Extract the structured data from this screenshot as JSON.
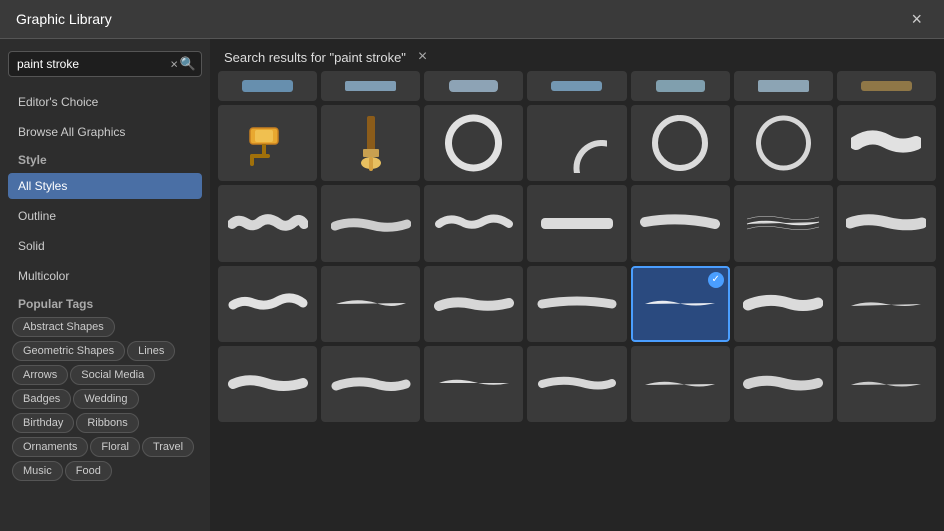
{
  "dialog": {
    "title": "Graphic Library",
    "close_label": "×"
  },
  "search": {
    "value": "paint stroke",
    "placeholder": "paint stroke",
    "clear_label": "×",
    "search_icon": "🔍"
  },
  "sidebar": {
    "editor_choice": "Editor's Choice",
    "browse_all": "Browse All Graphics",
    "style_label": "Style",
    "styles": [
      {
        "label": "All Styles",
        "active": true
      },
      {
        "label": "Outline",
        "active": false
      },
      {
        "label": "Solid",
        "active": false
      },
      {
        "label": "Multicolor",
        "active": false
      }
    ],
    "popular_tags_label": "Popular Tags",
    "tags": [
      "Abstract Shapes",
      "Geometric Shapes",
      "Lines",
      "Arrows",
      "Social Media",
      "Badges",
      "Wedding",
      "Birthday",
      "Ribbons",
      "Ornaments",
      "Floral",
      "Travel",
      "Music",
      "Food"
    ]
  },
  "results": {
    "title": "Search results for \"paint stroke\"",
    "clear_label": "×"
  },
  "graphics": {
    "rows": [
      {
        "id": "row1",
        "cells": [
          {
            "id": "g1",
            "type": "top-partial",
            "selected": false
          },
          {
            "id": "g2",
            "type": "top-partial",
            "selected": false
          },
          {
            "id": "g3",
            "type": "top-partial",
            "selected": false
          },
          {
            "id": "g4",
            "type": "top-partial",
            "selected": false
          },
          {
            "id": "g5",
            "type": "top-partial",
            "selected": false
          },
          {
            "id": "g6",
            "type": "top-partial",
            "selected": false
          },
          {
            "id": "g7",
            "type": "top-partial",
            "selected": false
          }
        ]
      }
    ]
  },
  "colors": {
    "accent": "#4a9eff",
    "active_bg": "#4a6fa5",
    "cell_bg": "#3a3a3a",
    "selected_bg": "#2a4a7f"
  }
}
